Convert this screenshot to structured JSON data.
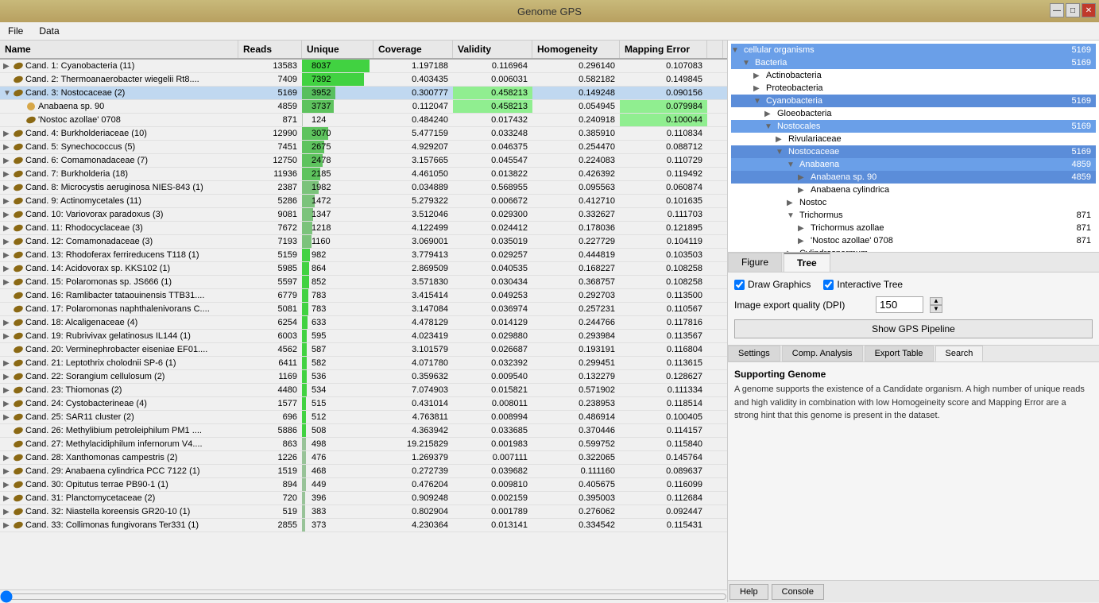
{
  "titlebar": {
    "title": "Genome GPS",
    "minimize": "—",
    "maximize": "□",
    "close": "✕"
  },
  "menu": {
    "items": [
      "File",
      "Data"
    ]
  },
  "table": {
    "columns": [
      "Name",
      "Reads",
      "Unique",
      "Coverage",
      "Validity",
      "Homogeneity",
      "Mapping Error"
    ],
    "rows": [
      {
        "name": "Cand. 1: Cyanobacteria (11)",
        "reads": "13583",
        "unique": "8037",
        "uniqueWidth": 80,
        "uniqueColor": "#22cc22",
        "coverage": "1.197188",
        "validity": "0.116964",
        "homogeneity": "0.296140",
        "mappingError": "0.107083",
        "expanded": false,
        "indent": 0,
        "validityHigh": false,
        "mappingHigh": false
      },
      {
        "name": "Cand. 2: Thermoanaerobacter wiegelii Rt8....",
        "reads": "7409",
        "unique": "7392",
        "uniqueWidth": 74,
        "uniqueColor": "#11dd11",
        "coverage": "0.403435",
        "validity": "0.006031",
        "homogeneity": "0.582182",
        "mappingError": "0.149845",
        "expanded": false,
        "indent": 0,
        "validityHigh": false,
        "mappingHigh": false
      },
      {
        "name": "Cand. 3: Nostocaceae (2)",
        "reads": "5169",
        "unique": "3952",
        "uniqueWidth": 40,
        "uniqueColor": "#88cc88",
        "coverage": "0.300777",
        "validity": "0.458213",
        "homogeneity": "0.149248",
        "mappingError": "0.090156",
        "expanded": true,
        "indent": 0,
        "selected": true,
        "validityHigh": true,
        "mappingHigh": false
      },
      {
        "name": "Anabaena sp. 90",
        "reads": "4859",
        "unique": "3737",
        "uniqueWidth": 37,
        "uniqueColor": "#88cc88",
        "coverage": "0.112047",
        "validity": "0.458213",
        "homogeneity": "0.054945",
        "mappingError": "0.079984",
        "expanded": false,
        "indent": 1,
        "isChild": true,
        "validityHigh": true,
        "mappingHigh": true
      },
      {
        "name": "'Nostoc azollae' 0708",
        "reads": "871",
        "unique": "124",
        "uniqueWidth": 2,
        "uniqueColor": "#cccccc",
        "coverage": "0.484240",
        "validity": "0.017432",
        "homogeneity": "0.240918",
        "mappingError": "0.100044",
        "expanded": false,
        "indent": 1,
        "isChild": true,
        "validityHigh": false,
        "mappingHigh": true
      },
      {
        "name": "Cand. 4: Burkholderiaceae (10)",
        "reads": "12990",
        "unique": "3070",
        "uniqueWidth": 31,
        "uniqueColor": "#44bb44",
        "coverage": "5.477159",
        "validity": "0.033248",
        "homogeneity": "0.385910",
        "mappingError": "0.110834",
        "expanded": false,
        "indent": 0
      },
      {
        "name": "Cand. 5: Synechococcus (5)",
        "reads": "7451",
        "unique": "2675",
        "uniqueWidth": 27,
        "uniqueColor": "#44bb44",
        "coverage": "4.929207",
        "validity": "0.046375",
        "homogeneity": "0.254470",
        "mappingError": "0.088712"
      },
      {
        "name": "Cand. 6: Comamonadaceae (7)",
        "reads": "12750",
        "unique": "2478",
        "uniqueWidth": 25,
        "uniqueColor": "#55bb55",
        "coverage": "3.157665",
        "validity": "0.045547",
        "homogeneity": "0.224083",
        "mappingError": "0.110729"
      },
      {
        "name": "Cand. 7: Burkholderia (18)",
        "reads": "11936",
        "unique": "2185",
        "uniqueWidth": 22,
        "uniqueColor": "#55bb55",
        "coverage": "4.461050",
        "validity": "0.013822",
        "homogeneity": "0.426392",
        "mappingError": "0.119492"
      },
      {
        "name": "Cand. 8: Microcystis aeruginosa NIES-843 (1)",
        "reads": "2387",
        "unique": "1982",
        "uniqueWidth": 20,
        "uniqueColor": "#22cc22",
        "coverage": "0.034889",
        "validity": "0.568955",
        "homogeneity": "0.095563",
        "mappingError": "0.060874"
      },
      {
        "name": "Cand. 9: Actinomycetales (11)",
        "reads": "5286",
        "unique": "1472",
        "uniqueWidth": 15,
        "uniqueColor": "#77bb77",
        "coverage": "5.279322",
        "validity": "0.006672",
        "homogeneity": "0.412710",
        "mappingError": "0.101635"
      },
      {
        "name": "Cand. 10: Variovorax paradoxus (3)",
        "reads": "9081",
        "unique": "1347",
        "uniqueWidth": 14,
        "uniqueColor": "#88bb88",
        "coverage": "3.512046",
        "validity": "0.029300",
        "homogeneity": "0.332627",
        "mappingError": "0.111703"
      },
      {
        "name": "Cand. 11: Rhodocyclaceae (3)",
        "reads": "7672",
        "unique": "1218",
        "uniqueWidth": 12,
        "uniqueColor": "#88bb88",
        "coverage": "4.122499",
        "validity": "0.024412",
        "homogeneity": "0.178036",
        "mappingError": "0.121895"
      },
      {
        "name": "Cand. 12: Comamonadaceae (3)",
        "reads": "7193",
        "unique": "1160",
        "uniqueWidth": 12,
        "uniqueColor": "#88bb88",
        "coverage": "3.069001",
        "validity": "0.035019",
        "homogeneity": "0.227729",
        "mappingError": "0.104119"
      },
      {
        "name": "Cand. 13: Rhodoferax ferrireducens T118 (1)",
        "reads": "5159",
        "unique": "982",
        "uniqueWidth": 10,
        "uniqueColor": "#99bb99",
        "coverage": "3.779413",
        "validity": "0.029257",
        "homogeneity": "0.444819",
        "mappingError": "0.103503"
      },
      {
        "name": "Cand. 14: Acidovorax sp. KKS102 (1)",
        "reads": "5985",
        "unique": "864",
        "uniqueWidth": 9,
        "uniqueColor": "#aabb99",
        "coverage": "2.869509",
        "validity": "0.040535",
        "homogeneity": "0.168227",
        "mappingError": "0.108258"
      },
      {
        "name": "Cand. 15: Polaromonas sp. JS666 (1)",
        "reads": "5597",
        "unique": "852",
        "uniqueWidth": 9,
        "uniqueColor": "#aabb99",
        "coverage": "3.571830",
        "validity": "0.030434",
        "homogeneity": "0.368757",
        "mappingError": "0.108258"
      },
      {
        "name": "Cand. 16: Ramlibacter tataouinensis TTB31....",
        "reads": "6779",
        "unique": "783",
        "uniqueWidth": 8,
        "uniqueColor": "#aabb99",
        "coverage": "3.415414",
        "validity": "0.049253",
        "homogeneity": "0.292703",
        "mappingError": "0.113500"
      },
      {
        "name": "Cand. 17: Polaromonas naphthalenivorans C....",
        "reads": "5081",
        "unique": "783",
        "uniqueWidth": 8,
        "uniqueColor": "#aabb99",
        "coverage": "3.147084",
        "validity": "0.036974",
        "homogeneity": "0.257231",
        "mappingError": "0.110567"
      },
      {
        "name": "Cand. 18: Alcaligenaceae (4)",
        "reads": "6254",
        "unique": "633",
        "uniqueWidth": 6,
        "uniqueColor": "#bbbbaa",
        "coverage": "4.478129",
        "validity": "0.014129",
        "homogeneity": "0.244766",
        "mappingError": "0.117816"
      },
      {
        "name": "Cand. 19: Rubrivivax gelatinosus IL144 (1)",
        "reads": "6003",
        "unique": "595",
        "uniqueWidth": 6,
        "uniqueColor": "#bbbbaa",
        "coverage": "4.023419",
        "validity": "0.029880",
        "homogeneity": "0.293984",
        "mappingError": "0.113567"
      },
      {
        "name": "Cand. 20: Verminephrobacter eiseniae EF01....",
        "reads": "4562",
        "unique": "587",
        "uniqueWidth": 6,
        "uniqueColor": "#bbbbaa",
        "coverage": "3.101579",
        "validity": "0.026687",
        "homogeneity": "0.193191",
        "mappingError": "0.116804"
      },
      {
        "name": "Cand. 21: Leptothrix cholodnii SP-6 (1)",
        "reads": "6411",
        "unique": "582",
        "uniqueWidth": 6,
        "uniqueColor": "#bbbbaa",
        "coverage": "4.071780",
        "validity": "0.032392",
        "homogeneity": "0.299451",
        "mappingError": "0.113615"
      },
      {
        "name": "Cand. 22: Sorangium cellulosum (2)",
        "reads": "1169",
        "unique": "536",
        "uniqueWidth": 5,
        "uniqueColor": "#22cc22",
        "coverage": "0.359632",
        "validity": "0.009540",
        "homogeneity": "0.132279",
        "mappingError": "0.128627"
      },
      {
        "name": "Cand. 23: Thiomonas (2)",
        "reads": "4480",
        "unique": "534",
        "uniqueWidth": 5,
        "uniqueColor": "#bbbbaa",
        "coverage": "7.074903",
        "validity": "0.015821",
        "homogeneity": "0.571902",
        "mappingError": "0.111334"
      },
      {
        "name": "Cand. 24: Cystobacterineae (4)",
        "reads": "1577",
        "unique": "515",
        "uniqueWidth": 5,
        "uniqueColor": "#22cc22",
        "coverage": "0.431014",
        "validity": "0.008011",
        "homogeneity": "0.238953",
        "mappingError": "0.118514"
      },
      {
        "name": "Cand. 25: SAR11 cluster (2)",
        "reads": "696",
        "unique": "512",
        "uniqueWidth": 5,
        "uniqueColor": "#22cc22",
        "coverage": "4.763811",
        "validity": "0.008994",
        "homogeneity": "0.486914",
        "mappingError": "0.100405"
      },
      {
        "name": "Cand. 26: Methylibium petroleiphilum PM1 ....",
        "reads": "5886",
        "unique": "508",
        "uniqueWidth": 5,
        "uniqueColor": "#bbbbaa",
        "coverage": "4.363942",
        "validity": "0.033685",
        "homogeneity": "0.370446",
        "mappingError": "0.114157"
      },
      {
        "name": "Cand. 27: Methylacidiphilum infernorum V4....",
        "reads": "863",
        "unique": "498",
        "uniqueWidth": 5,
        "uniqueColor": "#22cc22",
        "coverage": "19.215829",
        "validity": "0.001983",
        "homogeneity": "0.599752",
        "mappingError": "0.115840"
      },
      {
        "name": "Cand. 28: Xanthomonas campestris (2)",
        "reads": "1226",
        "unique": "476",
        "uniqueWidth": 5,
        "uniqueColor": "#44cc44",
        "coverage": "1.269379",
        "validity": "0.007111",
        "homogeneity": "0.322065",
        "mappingError": "0.145764"
      },
      {
        "name": "Cand. 29: Anabaena cylindrica PCC 7122 (1)",
        "reads": "1519",
        "unique": "468",
        "uniqueWidth": 5,
        "uniqueColor": "#44cc44",
        "coverage": "0.272739",
        "validity": "0.039682",
        "homogeneity": "0.111160",
        "mappingError": "0.089637"
      },
      {
        "name": "Cand. 30: Opitutus terrae PB90-1 (1)",
        "reads": "894",
        "unique": "449",
        "uniqueWidth": 5,
        "uniqueColor": "#44cc44",
        "coverage": "0.476204",
        "validity": "0.009810",
        "homogeneity": "0.405675",
        "mappingError": "0.116099"
      },
      {
        "name": "Cand. 31: Planctomycetaceae (2)",
        "reads": "720",
        "unique": "396",
        "uniqueWidth": 4,
        "uniqueColor": "#55cc55",
        "coverage": "0.909248",
        "validity": "0.002159",
        "homogeneity": "0.395003",
        "mappingError": "0.112684"
      },
      {
        "name": "Cand. 32: Niastella koreensis GR20-10 (1)",
        "reads": "519",
        "unique": "383",
        "uniqueWidth": 4,
        "uniqueColor": "#55cc55",
        "coverage": "0.802904",
        "validity": "0.001789",
        "homogeneity": "0.276062",
        "mappingError": "0.092447"
      },
      {
        "name": "Cand. 33: Collimonas fungivorans Ter331 (1)",
        "reads": "2855",
        "unique": "373",
        "uniqueWidth": 4,
        "uniqueColor": "#66cc66",
        "coverage": "4.230364",
        "validity": "0.013141",
        "homogeneity": "0.334542",
        "mappingError": "0.115431"
      }
    ]
  },
  "tree": {
    "nodes": [
      {
        "label": "cellular organisms",
        "count": "5169",
        "indent": 0,
        "expanded": true,
        "selected": true
      },
      {
        "label": "Bacteria",
        "count": "5169",
        "indent": 1,
        "expanded": true,
        "selected": true
      },
      {
        "label": "Actinobacteria",
        "count": "",
        "indent": 2,
        "expanded": false
      },
      {
        "label": "Proteobacteria",
        "count": "",
        "indent": 2,
        "expanded": false
      },
      {
        "label": "Cyanobacteria",
        "count": "5169",
        "indent": 2,
        "expanded": true,
        "selected": true,
        "highlighted": true
      },
      {
        "label": "Gloeobacteria",
        "count": "",
        "indent": 3,
        "expanded": false
      },
      {
        "label": "Nostocales",
        "count": "5169",
        "indent": 3,
        "expanded": true,
        "selected": true
      },
      {
        "label": "Rivulariaceae",
        "count": "",
        "indent": 4,
        "expanded": false
      },
      {
        "label": "Nostocaceae",
        "count": "5169",
        "indent": 4,
        "expanded": true,
        "selected": true,
        "highlighted": true
      },
      {
        "label": "Anabaena",
        "count": "4859",
        "indent": 5,
        "expanded": true,
        "selected": true
      },
      {
        "label": "Anabaena sp. 90",
        "count": "4859",
        "indent": 6,
        "expanded": false,
        "selected": true,
        "highlighted": true
      },
      {
        "label": "Anabaena cylindrica",
        "count": "",
        "indent": 6,
        "expanded": false
      },
      {
        "label": "Nostoc",
        "count": "",
        "indent": 5,
        "expanded": false
      },
      {
        "label": "Trichormus",
        "count": "871",
        "indent": 5,
        "expanded": true
      },
      {
        "label": "Trichormus azollae",
        "count": "871",
        "indent": 6,
        "expanded": false
      },
      {
        "label": "'Nostoc azollae' 0708",
        "count": "871",
        "indent": 6,
        "expanded": false
      },
      {
        "label": "Cylindrospermum",
        "count": "",
        "indent": 5,
        "expanded": false
      }
    ]
  },
  "tabs": {
    "figure": "Figure",
    "tree": "Tree"
  },
  "settings": {
    "drawGraphics": "Draw Graphics",
    "interactiveTree": "Interactive Tree",
    "dpiLabel": "Image export quality (DPI)",
    "dpiValue": "150",
    "showGPSPipeline": "Show GPS Pipeline"
  },
  "bottomTabs": {
    "settings": "Settings",
    "compAnalysis": "Comp. Analysis",
    "exportTable": "Export Table",
    "search": "Search"
  },
  "info": {
    "title": "Supporting Genome",
    "text": "A genome supports the existence of a Candidate organism. A high number of unique reads and high validity in combination with low Homogeineity score and Mapping Error are a strong hint that this genome is present in the dataset."
  },
  "footer": {
    "help": "Help",
    "console": "Console"
  }
}
